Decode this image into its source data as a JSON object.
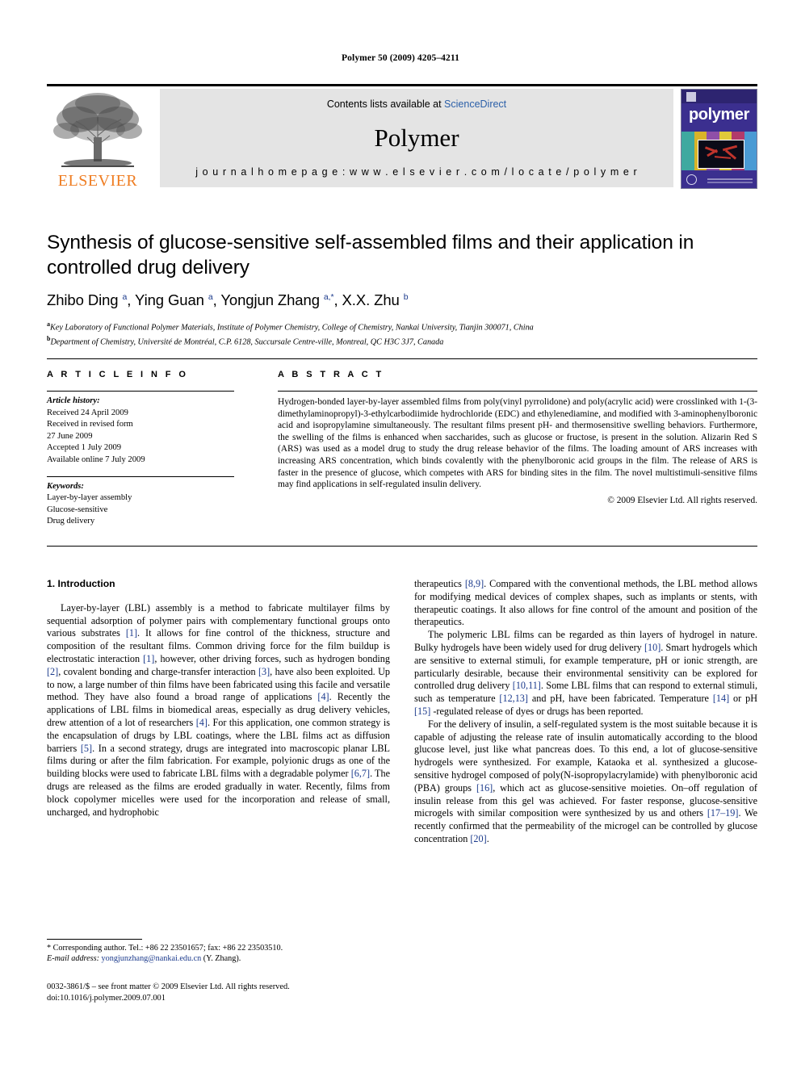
{
  "running_head": "Polymer 50 (2009) 4205–4211",
  "masthead": {
    "publisher_name": "ELSEVIER",
    "contents_prefix": "Contents lists available at ",
    "contents_link": "ScienceDirect",
    "journal_title": "Polymer",
    "homepage": "j o u r n a l   h o m e p a g e :   w w w . e l s e v i e r . c o m / l o c a t e / p o l y m e r",
    "cover_word": "polymer",
    "accent_orange": "#ef7d22",
    "link_blue": "#2b5fa8",
    "cover_blue": "#3b2f8f",
    "banner_gray": "#e4e4e4"
  },
  "article": {
    "title": "Synthesis of glucose-sensitive self-assembled films and their application in controlled drug delivery",
    "authors_html": "Zhibo Ding <sup>a</sup>, Ying Guan <sup>a</sup>, Yongjun Zhang <sup>a,*</sup>, X.X. Zhu <sup>b</sup>",
    "affiliation_a": "Key Laboratory of Functional Polymer Materials, Institute of Polymer Chemistry, College of Chemistry, Nankai University, Tianjin 300071, China",
    "affiliation_b": "Department of Chemistry, Université de Montréal, C.P. 6128, Succursale Centre-ville, Montreal, QC H3C 3J7, Canada"
  },
  "info": {
    "heading": "A R T I C L E   I N F O",
    "history_label": "Article history:",
    "history": [
      "Received 24 April 2009",
      "Received in revised form",
      "27 June 2009",
      "Accepted 1 July 2009",
      "Available online 7 July 2009"
    ],
    "keywords_label": "Keywords:",
    "keywords": [
      "Layer-by-layer assembly",
      "Glucose-sensitive",
      "Drug delivery"
    ]
  },
  "abstract": {
    "heading": "A B S T R A C T",
    "text": "Hydrogen-bonded layer-by-layer assembled films from poly(vinyl pyrrolidone) and poly(acrylic acid) were crosslinked with 1-(3-dimethylaminopropyl)-3-ethylcarbodiimide hydrochloride (EDC) and ethylenediamine, and modified with 3-aminophenylboronic acid and isopropylamine simultaneously. The resultant films present pH- and thermosensitive swelling behaviors. Furthermore, the swelling of the films is enhanced when saccharides, such as glucose or fructose, is present in the solution. Alizarin Red S (ARS) was used as a model drug to study the drug release behavior of the films. The loading amount of ARS increases with increasing ARS concentration, which binds covalently with the phenylboronic acid groups in the film. The release of ARS is faster in the presence of glucose, which competes with ARS for binding sites in the film. The novel multistimuli-sensitive films may find applications in self-regulated insulin delivery.",
    "copyright": "© 2009 Elsevier Ltd. All rights reserved."
  },
  "body": {
    "section_heading": "1.  Introduction",
    "left_paragraphs": [
      "Layer-by-layer (LBL) assembly is a method to fabricate multilayer films by sequential adsorption of polymer pairs with complementary functional groups onto various substrates [1]. It allows for fine control of the thickness, structure and composition of the resultant films. Common driving force for the film buildup is electrostatic interaction [1], however, other driving forces, such as hydrogen bonding [2], covalent bonding and charge-transfer interaction [3], have also been exploited. Up to now, a large number of thin films have been fabricated using this facile and versatile method. They have also found a broad range of applications [4]. Recently the applications of LBL films in biomedical areas, especially as drug delivery vehicles, drew attention of a lot of researchers [4]. For this application, one common strategy is the encapsulation of drugs by LBL coatings, where the LBL films act as diffusion barriers [5]. In a second strategy, drugs are integrated into macroscopic planar LBL films during or after the film fabrication. For example, polyionic drugs as one of the building blocks were used to fabricate LBL films with a degradable polymer [6,7]. The drugs are released as the films are eroded gradually in water. Recently, films from block copolymer micelles were used for the incorporation and release of small, uncharged, and hydrophobic"
    ],
    "right_paragraphs": [
      "therapeutics [8,9]. Compared with the conventional methods, the LBL method allows for modifying medical devices of complex shapes, such as implants or stents, with therapeutic coatings. It also allows for fine control of the amount and position of the therapeutics.",
      "The polymeric LBL films can be regarded as thin layers of hydrogel in nature. Bulky hydrogels have been widely used for drug delivery [10]. Smart hydrogels which are sensitive to external stimuli, for example temperature, pH or ionic strength, are particularly desirable, because their environmental sensitivity can be explored for controlled drug delivery [10,11]. Some LBL films that can respond to external stimuli, such as temperature [12,13] and pH, have been fabricated. Temperature [14] or pH [15] -regulated release of dyes or drugs has been reported.",
      "For the delivery of insulin, a self-regulated system is the most suitable because it is capable of adjusting the release rate of insulin automatically according to the blood glucose level, just like what pancreas does. To this end, a lot of glucose-sensitive hydrogels were synthesized. For example, Kataoka et al. synthesized a glucose-sensitive hydrogel composed of poly(N-isopropylacrylamide) with phenylboronic acid (PBA) groups [16], which act as glucose-sensitive moieties. On–off regulation of insulin release from this gel was achieved. For faster response, glucose-sensitive microgels with similar composition were synthesized by us and others [17–19]. We recently confirmed that the permeability of the microgel can be controlled by glucose concentration [20]."
    ]
  },
  "footnote": {
    "corresponding": "* Corresponding author. Tel.: +86 22 23501657; fax: +86 22 23503510.",
    "email_label": "E-mail address:",
    "email": "yongjunzhang@nankai.edu.cn",
    "email_suffix": "(Y. Zhang)."
  },
  "imprint": {
    "issn_line": "0032-3861/$ – see front matter © 2009 Elsevier Ltd. All rights reserved.",
    "doi_line": "doi:10.1016/j.polymer.2009.07.001"
  }
}
